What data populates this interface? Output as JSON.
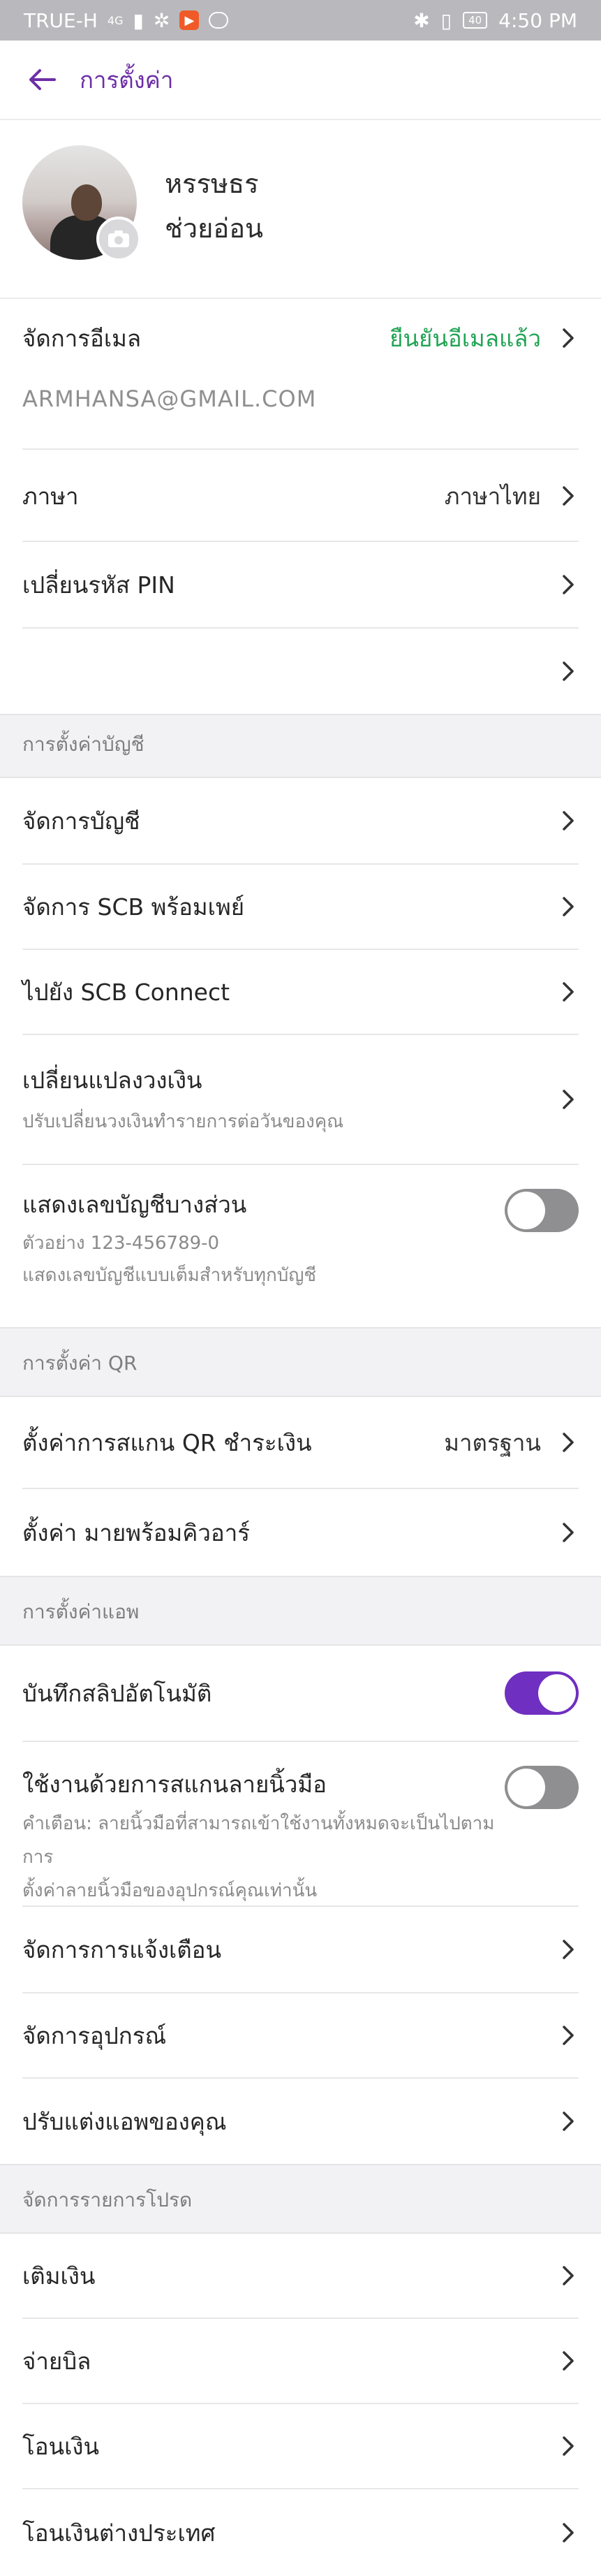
{
  "status_bar": {
    "carrier": "TRUE-H",
    "network": "4G",
    "time": "4:50 PM",
    "battery": "40"
  },
  "header": {
    "title": "การตั้งค่า"
  },
  "profile": {
    "first_name": "หรรษธร",
    "last_name": "ช่วยอ่อน"
  },
  "email": {
    "label": "จัดการอีเมล",
    "status": "ยืนยันอีเมลแล้ว",
    "address": "ARMHANSA@GMAIL.COM"
  },
  "language": {
    "label": "ภาษา",
    "value": "ภาษาไทย"
  },
  "pin": {
    "label": "เปลี่ยนรหัส PIN"
  },
  "empty_row": {
    "label": ""
  },
  "account_section": {
    "title": "การตั้งค่าบัญชี",
    "manage_account": "จัดการบัญชี",
    "promptpay": "จัดการ SCB พร้อมเพย์",
    "scb_connect": "ไปยัง SCB Connect",
    "limit": {
      "label": "เปลี่ยนแปลงวงเงิน",
      "sub": "ปรับเปลี่ยนวงเงินทำรายการต่อวันของคุณ"
    },
    "partial_number": {
      "label": "แสดงเลขบัญชีบางส่วน",
      "example": "ตัวอย่าง 123-456789-0",
      "sub": "แสดงเลขบัญชีแบบเต็มสำหรับทุกบัญชี",
      "enabled": false
    }
  },
  "qr_section": {
    "title": "การตั้งค่า QR",
    "scan_qr": {
      "label": "ตั้งค่าการสแกน QR ชำระเงิน",
      "value": "มาตรฐาน"
    },
    "merchant_qr": "ตั้งค่า มายพร้อมคิวอาร์"
  },
  "app_section": {
    "title": "การตั้งค่าแอพ",
    "auto_save": {
      "label": "บันทึกสลิปอัตโนมัติ",
      "enabled": true
    },
    "fingerprint": {
      "label": "ใช้งานด้วยการสแกนลายนิ้วมือ",
      "warning_1": "คำเตือน: ลายนิ้วมือที่สามารถเข้าใช้งานทั้งหมดจะเป็นไปตามการ",
      "warning_2": "ตั้งค่าลายนิ้วมือของอุปกรณ์คุณเท่านั้น",
      "enabled": false
    },
    "notifications": "จัดการการแจ้งเตือน",
    "devices": "จัดการอุปกรณ์",
    "customize": "ปรับแต่งแอพของคุณ"
  },
  "favorites_section": {
    "title": "จัดการรายการโปรด",
    "topup": "เติมเงิน",
    "bill_pay": "จ่ายบิล",
    "transfer": "โอนเงิน",
    "intl_transfer": "โอนเงินต่างประเทศ"
  },
  "colors": {
    "accent": "#6d2ea6",
    "toggle_on": "#6f2fc0",
    "verified": "#22a455",
    "status_bar": "#b9b9bd"
  }
}
